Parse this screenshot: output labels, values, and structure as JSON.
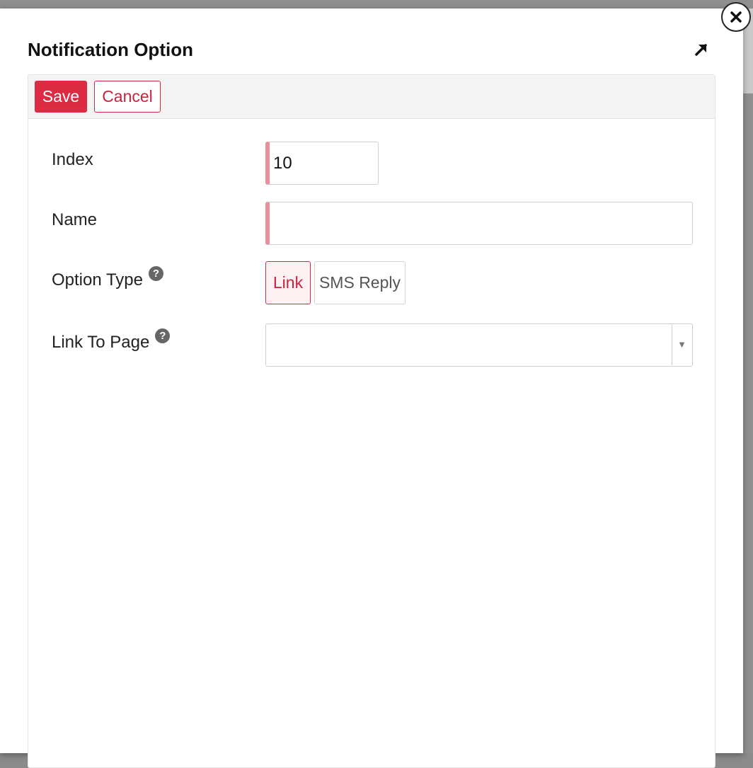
{
  "modal": {
    "title": "Notification Option",
    "expand_icon": "arrow-up-right-icon",
    "close_icon": "close-icon"
  },
  "toolbar": {
    "save_label": "Save",
    "cancel_label": "Cancel"
  },
  "form": {
    "index": {
      "label": "Index",
      "value": "10"
    },
    "name": {
      "label": "Name",
      "value": ""
    },
    "option_type": {
      "label": "Option Type",
      "help_icon": "question-circle-icon",
      "options": [
        "Link",
        "SMS Reply"
      ],
      "selected": "Link"
    },
    "link_to_page": {
      "label": "Link To Page",
      "help_icon": "question-circle-icon",
      "value": ""
    }
  },
  "colors": {
    "accent": "#dd2b44",
    "required_marker": "#e8909c",
    "backdrop": "#8f8f8f"
  }
}
